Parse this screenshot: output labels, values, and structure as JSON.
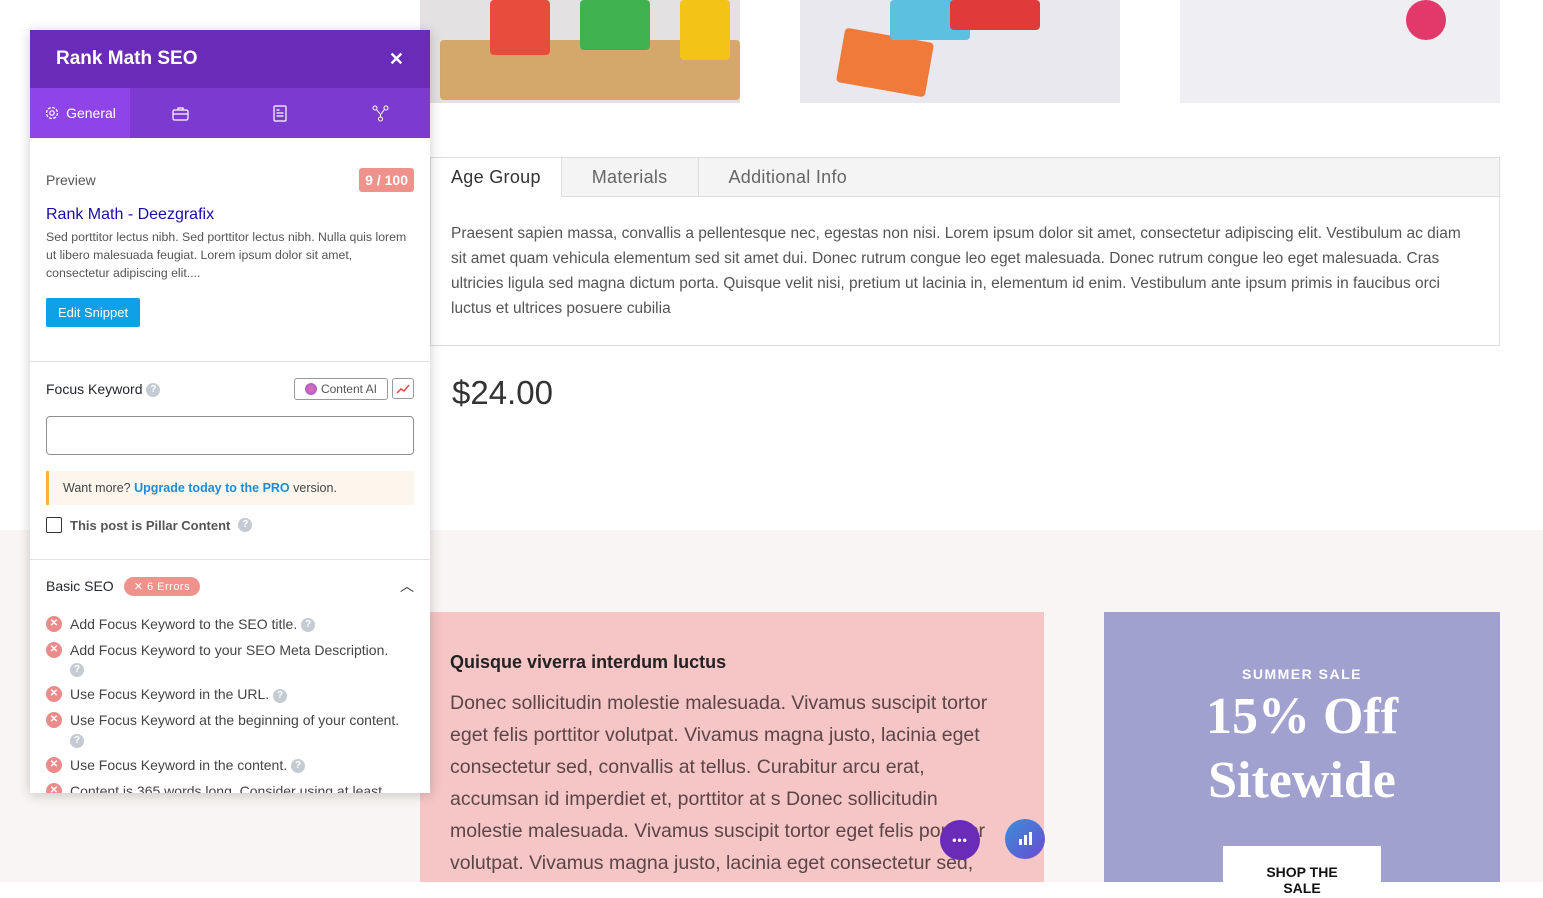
{
  "product_tabs": [
    "Age Group",
    "Materials",
    "Additional Info"
  ],
  "tab_content": "Praesent sapien massa, convallis a pellentesque nec, egestas non nisi. Lorem ipsum dolor sit amet, consectetur adipiscing elit. Vestibulum ac diam sit amet quam vehicula elementum sed sit amet dui. Donec rutrum congue leo eget malesuada. Donec rutrum congue leo eget malesuada. Cras ultricies ligula sed magna dictum porta. Quisque velit nisi, pretium ut lacinia in, elementum id enim. Vestibulum ante ipsum primis in faucibus orci luctus et ultrices posuere cubilia",
  "price": "$24.00",
  "promo": {
    "heading": "Quisque viverra interdum luctus",
    "body": "Donec sollicitudin molestie malesuada. Vivamus suscipit tortor eget felis porttitor volutpat. Vivamus magna justo, lacinia eget consectetur sed, convallis at tellus. Curabitur arcu erat, accumsan id imperdiet et, porttitor at s Donec sollicitudin molestie malesuada. Vivamus suscipit tortor eget felis porttitor volutpat. Vivamus magna justo, lacinia eget consectetur sed,"
  },
  "sale": {
    "eyebrow": "SUMMER SALE",
    "line1": "15% Off",
    "line2": "Sitewide",
    "button": "SHOP THE SALE"
  },
  "fab": {
    "more": "•••"
  },
  "panel": {
    "title": "Rank Math SEO",
    "close": "✕",
    "tabs": [
      {
        "label": "General",
        "icon": "gear-icon"
      },
      {
        "icon": "toolbox-icon"
      },
      {
        "icon": "schema-icon"
      },
      {
        "icon": "social-share-icon"
      }
    ],
    "preview_label": "Preview",
    "score": "9 / 100",
    "snippet_title": "Rank Math - Deezgrafix",
    "snippet_desc": "Sed porttitor lectus nibh. Sed porttitor lectus nibh. Nulla quis lorem ut libero malesuada feugiat. Lorem ipsum dolor sit amet, consectetur adipiscing elit....",
    "edit_snippet": "Edit Snippet",
    "focus_keyword": "Focus Keyword",
    "content_ai": "Content AI",
    "keyword_value": "",
    "upgrade_pre": "Want more? ",
    "upgrade_link": "Upgrade today to the PRO",
    "upgrade_post": " version.",
    "pillar": "This post is Pillar Content",
    "basic_seo": "Basic SEO",
    "errors_badge": "✕ 6 Errors",
    "checks": [
      "Add Focus Keyword to the SEO title.",
      "Add Focus Keyword to your SEO Meta Description.",
      "Use Focus Keyword in the URL.",
      "Use Focus Keyword at the beginning of your content.",
      "Use Focus Keyword in the content.",
      "Content is 365 words long. Consider using at least"
    ]
  },
  "colors": {
    "panel_header": "#6a2cb8",
    "panel_tabs": "#7c3ad0",
    "score_bad": "#f0928c",
    "link": "#1a0dab",
    "button": "#0fa0e6",
    "promo_pink": "#f6c5c5",
    "sale_purple": "#a0a1cf"
  }
}
